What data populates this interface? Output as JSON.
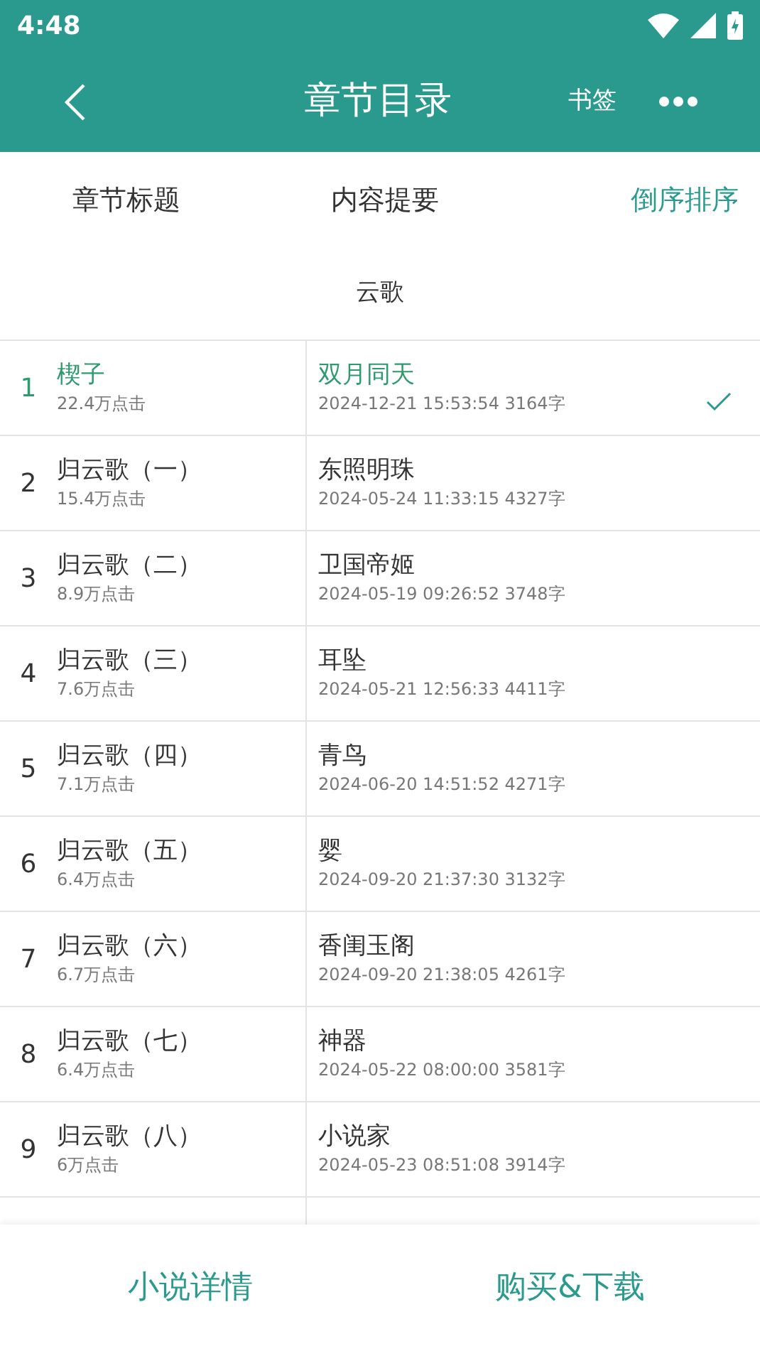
{
  "status_bar": {
    "time": "4:48"
  },
  "header": {
    "title": "章节目录",
    "bookmark": "书签"
  },
  "columns": [
    {
      "label": "章节标题",
      "kind": "plain"
    },
    {
      "label": "内容提要",
      "kind": "plain"
    },
    {
      "label": "倒序排序",
      "kind": "action"
    }
  ],
  "volume": "云歌",
  "chapters": [
    {
      "index": "1",
      "title": "楔子",
      "clicks": "22.4万点击",
      "summary": "双月同天",
      "date": "2024-12-21 15:53:54",
      "words": "3164字",
      "selected": true
    },
    {
      "index": "2",
      "title": "归云歌（一）",
      "clicks": "15.4万点击",
      "summary": "东照明珠",
      "date": "2024-05-24 11:33:15",
      "words": "4327字",
      "selected": false
    },
    {
      "index": "3",
      "title": "归云歌（二）",
      "clicks": "8.9万点击",
      "summary": "卫国帝姬",
      "date": "2024-05-19 09:26:52",
      "words": "3748字",
      "selected": false
    },
    {
      "index": "4",
      "title": "归云歌（三）",
      "clicks": "7.6万点击",
      "summary": "耳坠",
      "date": "2024-05-21 12:56:33",
      "words": "4411字",
      "selected": false
    },
    {
      "index": "5",
      "title": "归云歌（四）",
      "clicks": "7.1万点击",
      "summary": "青鸟",
      "date": "2024-06-20 14:51:52",
      "words": "4271字",
      "selected": false
    },
    {
      "index": "6",
      "title": "归云歌（五）",
      "clicks": "6.4万点击",
      "summary": "婴",
      "date": "2024-09-20 21:37:30",
      "words": "3132字",
      "selected": false
    },
    {
      "index": "7",
      "title": "归云歌（六）",
      "clicks": "6.7万点击",
      "summary": "香闺玉阁",
      "date": "2024-09-20 21:38:05",
      "words": "4261字",
      "selected": false
    },
    {
      "index": "8",
      "title": "归云歌（七）",
      "clicks": "6.4万点击",
      "summary": "神器",
      "date": "2024-05-22 08:00:00",
      "words": "3581字",
      "selected": false
    },
    {
      "index": "9",
      "title": "归云歌（八）",
      "clicks": "6万点击",
      "summary": "小说家",
      "date": "2024-05-23 08:51:08",
      "words": "3914字",
      "selected": false
    }
  ],
  "bottom_buttons": [
    "小说详情",
    "购买&下载"
  ]
}
